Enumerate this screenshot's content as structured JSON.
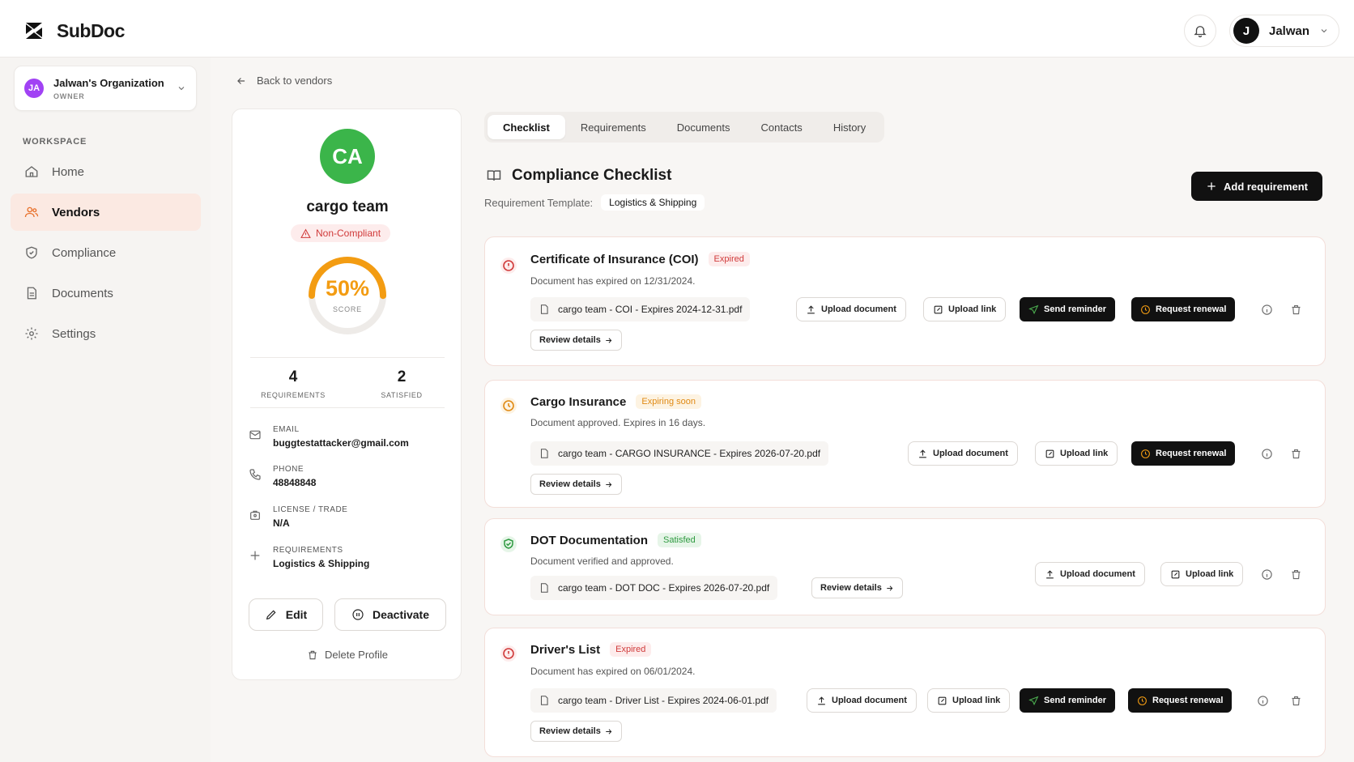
{
  "app": {
    "name": "SubDoc"
  },
  "user": {
    "initial": "J",
    "name": "Jalwan"
  },
  "org": {
    "initials": "JA",
    "name": "Jalwan's Organization",
    "role": "OWNER"
  },
  "sidebar": {
    "section_label": "WORKSPACE",
    "items": [
      {
        "label": "Home"
      },
      {
        "label": "Vendors"
      },
      {
        "label": "Compliance"
      },
      {
        "label": "Documents"
      },
      {
        "label": "Settings"
      }
    ]
  },
  "back_link": "Back to vendors",
  "vendor": {
    "initials": "CA",
    "name": "cargo team",
    "status": "Non-Compliant",
    "score": "50%",
    "score_fraction": 0.5,
    "score_label": "SCORE",
    "stats": [
      {
        "value": "4",
        "label": "REQUIREMENTS"
      },
      {
        "value": "2",
        "label": "SATISFIED"
      }
    ],
    "fields": [
      {
        "label": "EMAIL",
        "value": "buggtestattacker@gmail.com"
      },
      {
        "label": "PHONE",
        "value": "48848848"
      },
      {
        "label": "LICENSE / TRADE",
        "value": "N/A"
      },
      {
        "label": "REQUIREMENTS",
        "value": "Logistics & Shipping"
      }
    ],
    "edit_label": "Edit",
    "deactivate_label": "Deactivate",
    "delete_label": "Delete Profile"
  },
  "tabs": [
    {
      "label": "Checklist"
    },
    {
      "label": "Requirements"
    },
    {
      "label": "Documents"
    },
    {
      "label": "Contacts"
    },
    {
      "label": "History"
    }
  ],
  "checklist": {
    "title": "Compliance Checklist",
    "template_label": "Requirement Template:",
    "template_value": "Logistics & Shipping",
    "add_button": "Add requirement"
  },
  "actions": {
    "upload_document": "Upload document",
    "upload_link": "Upload link",
    "send_reminder": "Send reminder",
    "request_renewal": "Request renewal",
    "review_details": "Review details"
  },
  "requirements": [
    {
      "name": "Certificate of Insurance (COI)",
      "badge": "Expired",
      "desc": "Document has expired on 12/31/2024.",
      "file": "cargo team - COI - Expires 2024-12-31.pdf"
    },
    {
      "name": "Cargo Insurance",
      "badge": "Expiring soon",
      "desc": "Document approved. Expires in 16 days.",
      "file": "cargo team - CARGO INSURANCE - Expires 2026-07-20.pdf"
    },
    {
      "name": "DOT Documentation",
      "badge": "Satisfed",
      "desc": "Document verified and approved.",
      "file": "cargo team - DOT DOC - Expires 2026-07-20.pdf"
    },
    {
      "name": "Driver's List",
      "badge": "Expired",
      "desc": "Document has expired on 06/01/2024.",
      "file": "cargo team - Driver List - Expires 2024-06-01.pdf"
    }
  ],
  "colors": {
    "accent_orange": "#f39c12",
    "danger": "#d03a3a",
    "success": "#2e9a40",
    "warning": "#e08a14",
    "vendor_avatar": "#3bb54a"
  }
}
